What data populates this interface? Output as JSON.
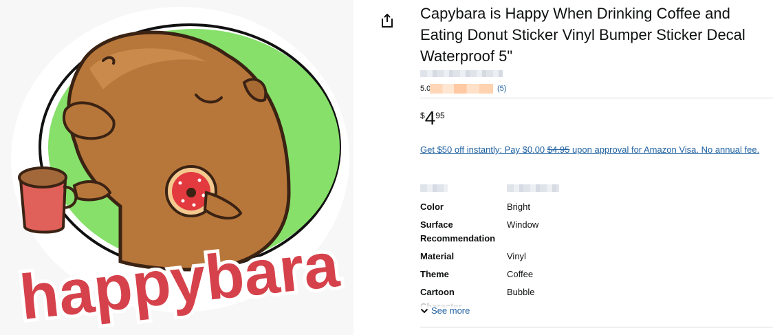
{
  "product": {
    "title": "Capybara is Happy When Drinking Coffee and Eating Donut Sticker Vinyl Bumper Sticker Decal Waterproof 5\"",
    "image_text": "happybara",
    "rating_value": "5.0",
    "rating_count": "(5)",
    "price": {
      "symbol": "$",
      "whole": "4",
      "fraction": "95"
    },
    "promo": {
      "prefix": "Get $50 off instantly: Pay $0.00 ",
      "strike_price": "$4.95",
      "suffix": " upon approval for Amazon Visa. No annual fee."
    },
    "attributes": [
      {
        "key": "Color",
        "value": "Bright"
      },
      {
        "key": "Surface Recommendation",
        "value": "Window"
      },
      {
        "key": "Material",
        "value": "Vinyl"
      },
      {
        "key": "Theme",
        "value": "Coffee"
      },
      {
        "key": "Cartoon",
        "value": "Bubble"
      }
    ],
    "faded_attribute_key": "Character",
    "see_more_label": "See more"
  },
  "icons": {
    "share": "share-icon",
    "chevron": "chevron-down-icon"
  },
  "colors": {
    "link": "#2162a1",
    "text": "#0f1111",
    "divider": "#d5d9d9",
    "capybara_body": "#b8773a",
    "sticker_green": "#86e06a",
    "lettering": "#d6424b"
  }
}
